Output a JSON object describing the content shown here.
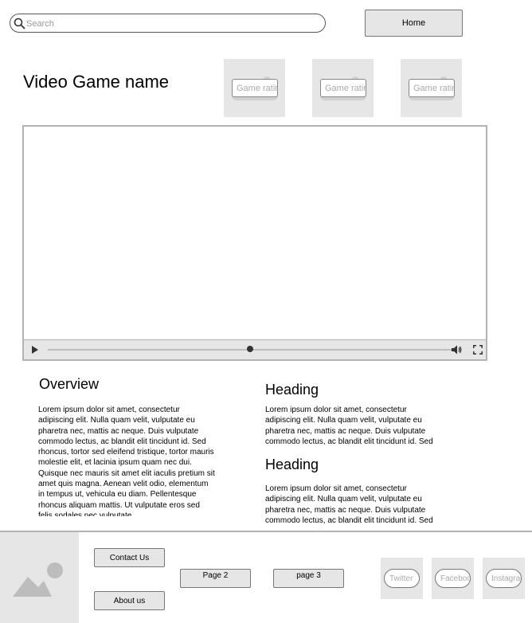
{
  "search": {
    "placeholder": "Search"
  },
  "nav": {
    "home_label": "Home"
  },
  "game": {
    "title": "Video Game name"
  },
  "ratings": [
    {
      "label": "Game rating"
    },
    {
      "label": "Game rating"
    },
    {
      "label": "Game rating"
    }
  ],
  "video": {
    "progress": 0.5
  },
  "overview": {
    "heading": "Overview",
    "text": "Lorem ipsum dolor sit amet, consectetur adipiscing elit. Nulla quam velit, vulputate eu pharetra nec, mattis ac neque. Duis vulputate commodo lectus, ac blandit elit tincidunt id. Sed rhoncus, tortor sed eleifend tristique, tortor mauris molestie elit, et lacinia ipsum quam nec dui. Quisque nec mauris sit amet elit iaculis pretium sit amet quis magna. Aenean velit odio, elementum in tempus ut, vehicula eu diam. Pellentesque rhoncus aliquam mattis. Ut vulputate eros sed felis sodales nec vulputate"
  },
  "sections": [
    {
      "heading": "Heading",
      "text": "Lorem ipsum dolor sit amet, consectetur adipiscing elit. Nulla quam velit, vulputate eu pharetra nec, mattis ac neque. Duis vulputate commodo lectus, ac blandit elit tincidunt id. Sed"
    },
    {
      "heading": "Heading",
      "text": "Lorem ipsum dolor sit amet, consectetur adipiscing elit. Nulla quam velit, vulputate eu pharetra nec, mattis ac neque. Duis vulputate commodo lectus, ac blandit elit tincidunt id. Sed"
    }
  ],
  "footer": {
    "contact_label": "Contact Us",
    "about_label": "About us",
    "page2_label": "Page 2",
    "page3_label": "page 3",
    "social": [
      {
        "label": "Twitter"
      },
      {
        "label": "Facebook"
      },
      {
        "label": "Instagram"
      }
    ]
  }
}
